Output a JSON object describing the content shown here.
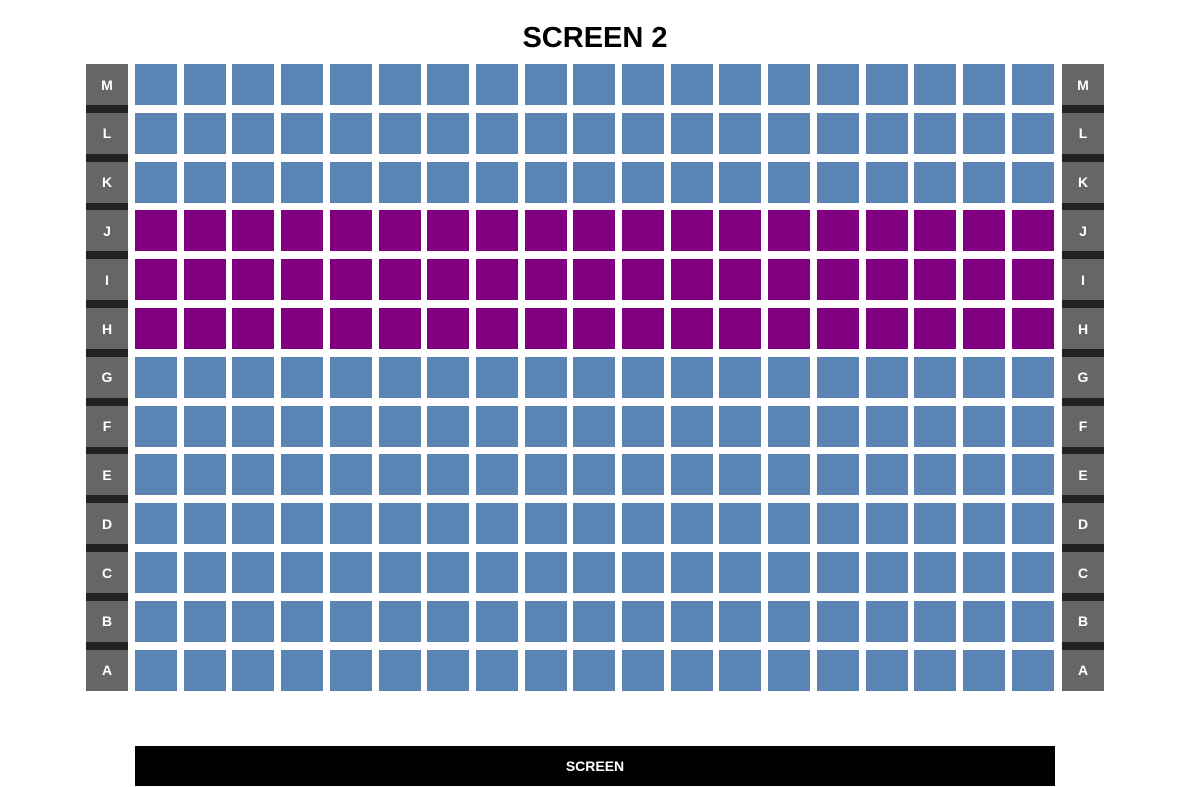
{
  "title": "SCREEN 2",
  "screen_label": "SCREEN",
  "rows": [
    "M",
    "L",
    "K",
    "J",
    "I",
    "H",
    "G",
    "F",
    "E",
    "D",
    "C",
    "B",
    "A"
  ],
  "seats_per_row": 19,
  "highlighted_rows": [
    "J",
    "I",
    "H"
  ],
  "colors": {
    "seat_available": "#5a84b3",
    "seat_highlighted": "#800080",
    "row_label_bg": "#666666",
    "row_separator": "#222222",
    "screen_bar": "#000000"
  }
}
